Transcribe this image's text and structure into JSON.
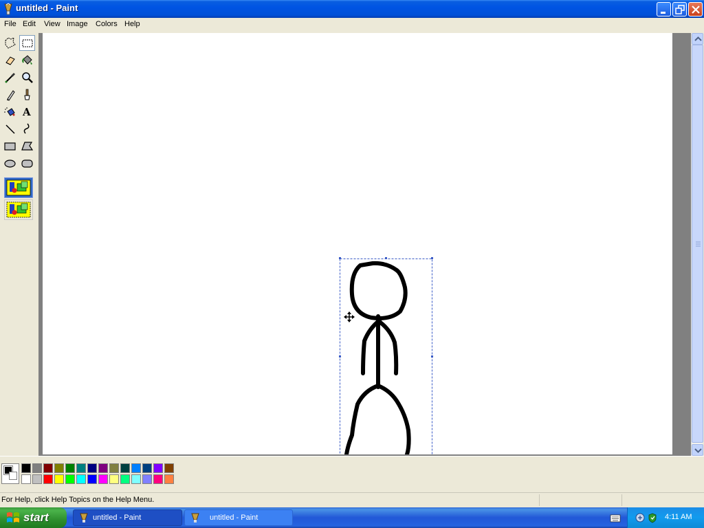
{
  "window": {
    "title": "untitled - Paint"
  },
  "menu": {
    "items": [
      "File",
      "Edit",
      "View",
      "Image",
      "Colors",
      "Help"
    ]
  },
  "tools": [
    {
      "name": "free-form-select-icon"
    },
    {
      "name": "select-icon"
    },
    {
      "name": "eraser-icon"
    },
    {
      "name": "fill-icon"
    },
    {
      "name": "pick-color-icon"
    },
    {
      "name": "magnifier-icon"
    },
    {
      "name": "pencil-icon"
    },
    {
      "name": "brush-icon"
    },
    {
      "name": "airbrush-icon"
    },
    {
      "name": "text-icon"
    },
    {
      "name": "line-icon"
    },
    {
      "name": "curve-icon"
    },
    {
      "name": "rectangle-icon"
    },
    {
      "name": "polygon-icon"
    },
    {
      "name": "ellipse-icon"
    },
    {
      "name": "rounded-rectangle-icon"
    }
  ],
  "tool_text_glyph": "A",
  "palette": {
    "row1": [
      "#000000",
      "#808080",
      "#800000",
      "#808000",
      "#008000",
      "#008080",
      "#000080",
      "#800080",
      "#808040",
      "#004040",
      "#0080ff",
      "#004080",
      "#8000ff",
      "#804000"
    ],
    "row2": [
      "#ffffff",
      "#c0c0c0",
      "#ff0000",
      "#ffff00",
      "#00ff00",
      "#00ffff",
      "#0000ff",
      "#ff00ff",
      "#ffff80",
      "#00ff80",
      "#80ffff",
      "#8080ff",
      "#ff0080",
      "#ff8040"
    ]
  },
  "status": {
    "help_text": "For Help, click Help Topics on the Help Menu."
  },
  "taskbar": {
    "start_label": "start",
    "tasks": [
      {
        "label": "untitled - Paint",
        "active": true
      },
      {
        "label": "untitled - Paint",
        "active": false
      }
    ],
    "clock": "4:11 AM"
  }
}
